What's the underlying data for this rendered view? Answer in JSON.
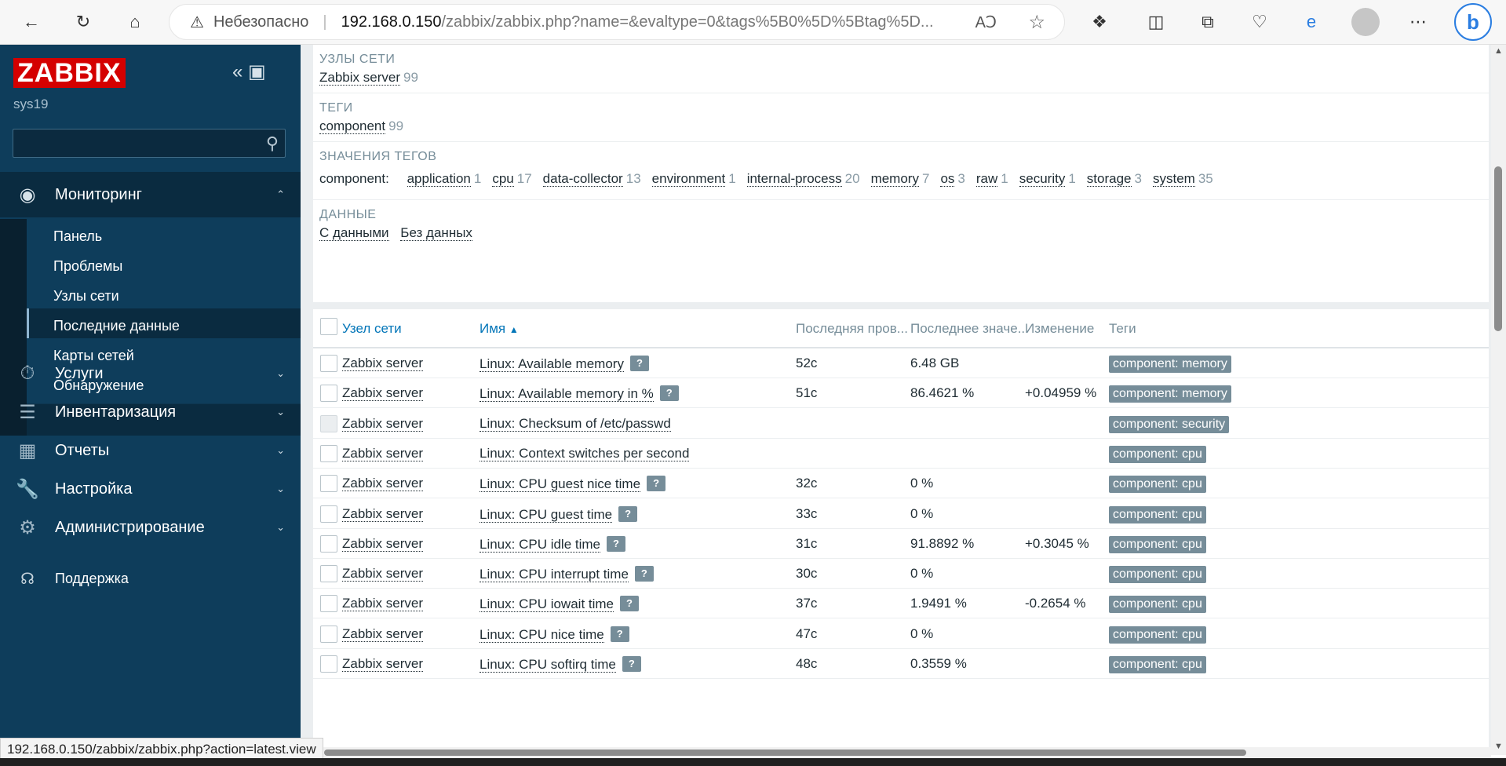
{
  "browser": {
    "insecure_label": "Небезопасно",
    "url_host": "192.168.0.150",
    "url_path": "/zabbix/zabbix.php?name=&evaltype=0&tags%5B0%5D%5Btag%5D...",
    "status_url": "192.168.0.150/zabbix/zabbix.php?action=latest.view"
  },
  "sidebar": {
    "logo": "ZABBIX",
    "server": "sys19",
    "menu": {
      "monitoring": "Мониторинг",
      "services": "Услуги",
      "inventory": "Инвентаризация",
      "reports": "Отчеты",
      "config": "Настройка",
      "admin": "Администрирование"
    },
    "submenu": [
      "Панель",
      "Проблемы",
      "Узлы сети",
      "Последние данные",
      "Карты сетей",
      "Обнаружение"
    ],
    "support": "Поддержка"
  },
  "filter": {
    "hosts_title": "УЗЛЫ СЕТИ",
    "host_value": "Zabbix server",
    "host_count": "99",
    "tags_title": "ТЕГИ",
    "tag_value": "component",
    "tag_count": "99",
    "tagvalues_title": "ЗНАЧЕНИЯ ТЕГОВ",
    "tagvalues_prefix": "component:",
    "tag_values": [
      {
        "name": "application",
        "count": "1"
      },
      {
        "name": "cpu",
        "count": "17"
      },
      {
        "name": "data-collector",
        "count": "13"
      },
      {
        "name": "environment",
        "count": "1"
      },
      {
        "name": "internal-process",
        "count": "20"
      },
      {
        "name": "memory",
        "count": "7"
      },
      {
        "name": "os",
        "count": "3"
      },
      {
        "name": "raw",
        "count": "1"
      },
      {
        "name": "security",
        "count": "1"
      },
      {
        "name": "storage",
        "count": "3"
      },
      {
        "name": "system",
        "count": "35"
      }
    ],
    "data_title": "ДАННЫЕ",
    "with_data": "С данными",
    "without_data": "Без данных"
  },
  "table": {
    "headers": {
      "host": "Узел сети",
      "name": "Имя",
      "last_check": "Последняя пров...",
      "last_value": "Последнее значе...",
      "change": "Изменение",
      "tags": "Теги"
    },
    "rows": [
      {
        "host": "Zabbix server",
        "name": "Linux: Available memory",
        "help": true,
        "last_check": "52с",
        "last_value": "6.48 GB",
        "change": "",
        "tag": "component: memory",
        "disabled": false
      },
      {
        "host": "Zabbix server",
        "name": "Linux: Available memory in %",
        "help": true,
        "last_check": "51с",
        "last_value": "86.4621 %",
        "change": "+0.04959 %",
        "tag": "component: memory",
        "disabled": false
      },
      {
        "host": "Zabbix server",
        "name": "Linux: Checksum of /etc/passwd",
        "help": false,
        "last_check": "",
        "last_value": "",
        "change": "",
        "tag": "component: security",
        "disabled": true
      },
      {
        "host": "Zabbix server",
        "name": "Linux: Context switches per second",
        "help": false,
        "last_check": "",
        "last_value": "",
        "change": "",
        "tag": "component: cpu",
        "disabled": false
      },
      {
        "host": "Zabbix server",
        "name": "Linux: CPU guest nice time",
        "help": true,
        "last_check": "32с",
        "last_value": "0 %",
        "change": "",
        "tag": "component: cpu",
        "disabled": false
      },
      {
        "host": "Zabbix server",
        "name": "Linux: CPU guest time",
        "help": true,
        "last_check": "33с",
        "last_value": "0 %",
        "change": "",
        "tag": "component: cpu",
        "disabled": false
      },
      {
        "host": "Zabbix server",
        "name": "Linux: CPU idle time",
        "help": true,
        "last_check": "31с",
        "last_value": "91.8892 %",
        "change": "+0.3045 %",
        "tag": "component: cpu",
        "disabled": false
      },
      {
        "host": "Zabbix server",
        "name": "Linux: CPU interrupt time",
        "help": true,
        "last_check": "30с",
        "last_value": "0 %",
        "change": "",
        "tag": "component: cpu",
        "disabled": false
      },
      {
        "host": "Zabbix server",
        "name": "Linux: CPU iowait time",
        "help": true,
        "last_check": "37с",
        "last_value": "1.9491 %",
        "change": "-0.2654 %",
        "tag": "component: cpu",
        "disabled": false
      },
      {
        "host": "Zabbix server",
        "name": "Linux: CPU nice time",
        "help": true,
        "last_check": "47с",
        "last_value": "0 %",
        "change": "",
        "tag": "component: cpu",
        "disabled": false
      },
      {
        "host": "Zabbix server",
        "name": "Linux: CPU softirq time",
        "help": true,
        "last_check": "48с",
        "last_value": "0.3559 %",
        "change": "",
        "tag": "component: cpu",
        "disabled": false
      }
    ],
    "help_glyph": "?"
  }
}
